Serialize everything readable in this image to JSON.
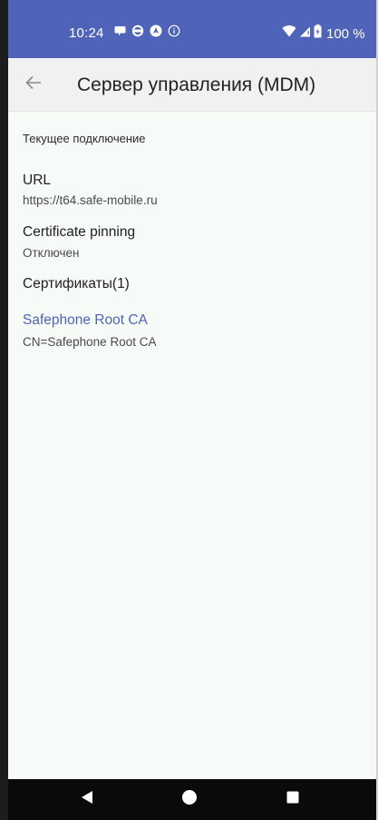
{
  "colors": {
    "status_bar": "#4f64b8",
    "toolbar": "#f0f2f1",
    "screen_background": "#f7fbf8",
    "accent_link": "#4f64b8",
    "nav_bar": "#0a0a0a"
  },
  "status_bar": {
    "time": "10:24",
    "battery_text": "100 %",
    "icons": [
      "chat-bubble-icon",
      "sync-icon",
      "navigation-icon",
      "info-icon",
      "wifi-icon",
      "cellular-signal-icon",
      "battery-icon"
    ]
  },
  "toolbar": {
    "back_icon": "arrow-back-icon",
    "title": "Сервер управления (MDM)"
  },
  "content": {
    "section_header": "Текущее подключение",
    "url": {
      "label": "URL",
      "value": "https://t64.safe-mobile.ru"
    },
    "pinning": {
      "label": "Certificate pinning",
      "value": "Отключен"
    },
    "certificates": {
      "label": "Сертификаты(1)",
      "items": [
        {
          "name": "Safephone Root CA",
          "subject": "CN=Safephone Root CA"
        }
      ]
    }
  },
  "nav_bar": {
    "icons": [
      "back-triangle-icon",
      "home-circle-icon",
      "recents-square-icon"
    ]
  }
}
